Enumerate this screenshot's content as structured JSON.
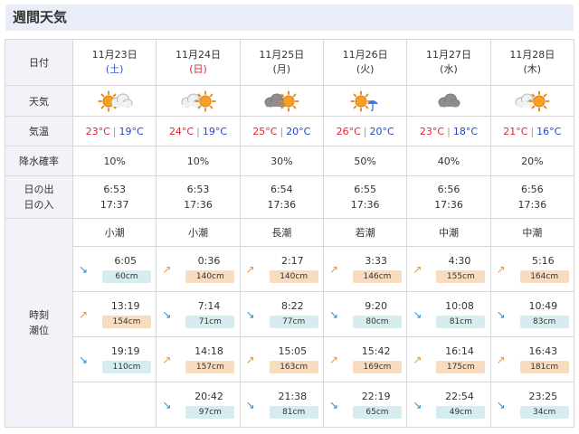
{
  "title": "週間天気",
  "labels": {
    "date": "日付",
    "weather": "天気",
    "temp": "気温",
    "rain": "降水確率",
    "sunrise": "日の出",
    "sunset": "日の入",
    "tide_time": "時刻",
    "tide_level": "潮位"
  },
  "temp_separator": "|",
  "colors": {
    "max": "#e0242a",
    "min": "#1f47d8",
    "sat": "#2b56c4",
    "sun": "#d42d2d",
    "rising": "#f0962a",
    "falling": "#2f8fcf"
  },
  "days": [
    {
      "date": "11月23日",
      "dow": "(土)",
      "dow_type": "sat",
      "weather_icon": "sun-cloud-icon",
      "max": "23°C",
      "min": "19°C",
      "rain": "10%",
      "sunrise": "6:53",
      "sunset": "17:37",
      "tide_name": "小潮",
      "tides": [
        {
          "time": "6:05",
          "level": "60cm",
          "dir": "down"
        },
        {
          "time": "13:19",
          "level": "154cm",
          "dir": "up"
        },
        {
          "time": "19:19",
          "level": "110cm",
          "dir": "down"
        },
        null
      ]
    },
    {
      "date": "11月24日",
      "dow": "(日)",
      "dow_type": "sun",
      "weather_icon": "cloud-sun-icon",
      "max": "24°C",
      "min": "19°C",
      "rain": "10%",
      "sunrise": "6:53",
      "sunset": "17:36",
      "tide_name": "小潮",
      "tides": [
        {
          "time": "0:36",
          "level": "140cm",
          "dir": "up"
        },
        {
          "time": "7:14",
          "level": "71cm",
          "dir": "down"
        },
        {
          "time": "14:18",
          "level": "157cm",
          "dir": "up"
        },
        {
          "time": "20:42",
          "level": "97cm",
          "dir": "down"
        }
      ]
    },
    {
      "date": "11月25日",
      "dow": "(月)",
      "dow_type": "week",
      "weather_icon": "darkcloud-sun-icon",
      "max": "25°C",
      "min": "20°C",
      "rain": "30%",
      "sunrise": "6:54",
      "sunset": "17:36",
      "tide_name": "長潮",
      "tides": [
        {
          "time": "2:17",
          "level": "140cm",
          "dir": "up"
        },
        {
          "time": "8:22",
          "level": "77cm",
          "dir": "down"
        },
        {
          "time": "15:05",
          "level": "163cm",
          "dir": "up"
        },
        {
          "time": "21:38",
          "level": "81cm",
          "dir": "down"
        }
      ]
    },
    {
      "date": "11月26日",
      "dow": "(火)",
      "dow_type": "week",
      "weather_icon": "sun-umbrella-icon",
      "max": "26°C",
      "min": "20°C",
      "rain": "50%",
      "sunrise": "6:55",
      "sunset": "17:36",
      "tide_name": "若潮",
      "tides": [
        {
          "time": "3:33",
          "level": "146cm",
          "dir": "up"
        },
        {
          "time": "9:20",
          "level": "80cm",
          "dir": "down"
        },
        {
          "time": "15:42",
          "level": "169cm",
          "dir": "up"
        },
        {
          "time": "22:19",
          "level": "65cm",
          "dir": "down"
        }
      ]
    },
    {
      "date": "11月27日",
      "dow": "(水)",
      "dow_type": "week",
      "weather_icon": "cloud-icon",
      "max": "23°C",
      "min": "18°C",
      "rain": "40%",
      "sunrise": "6:56",
      "sunset": "17:36",
      "tide_name": "中潮",
      "tides": [
        {
          "time": "4:30",
          "level": "155cm",
          "dir": "up"
        },
        {
          "time": "10:08",
          "level": "81cm",
          "dir": "down"
        },
        {
          "time": "16:14",
          "level": "175cm",
          "dir": "up"
        },
        {
          "time": "22:54",
          "level": "49cm",
          "dir": "down"
        }
      ]
    },
    {
      "date": "11月28日",
      "dow": "(木)",
      "dow_type": "week",
      "weather_icon": "cloud-sun-icon",
      "max": "21°C",
      "min": "16°C",
      "rain": "20%",
      "sunrise": "6:56",
      "sunset": "17:36",
      "tide_name": "中潮",
      "tides": [
        {
          "time": "5:16",
          "level": "164cm",
          "dir": "up"
        },
        {
          "time": "10:49",
          "level": "83cm",
          "dir": "down"
        },
        {
          "time": "16:43",
          "level": "181cm",
          "dir": "up"
        },
        {
          "time": "23:25",
          "level": "34cm",
          "dir": "down"
        }
      ]
    }
  ]
}
